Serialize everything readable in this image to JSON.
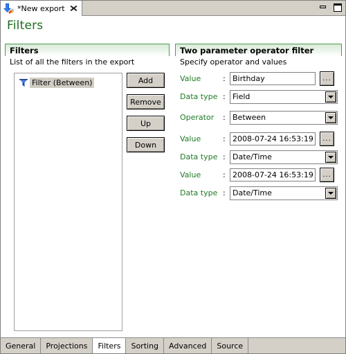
{
  "window": {
    "editor_tab": {
      "label": "*New export",
      "icon": "export-arrow-pencil-icon",
      "close_icon": "close-icon"
    },
    "controls": [
      {
        "name": "minimize-button",
        "icon": "minimize-icon"
      },
      {
        "name": "maximize-button",
        "icon": "maximize-icon"
      }
    ]
  },
  "page": {
    "title": "Filters"
  },
  "left_group": {
    "header": "Filters",
    "subtitle": "List of all the filters in the export",
    "tree": {
      "items": [
        {
          "label": "Filter (Between)",
          "icon": "funnel-icon",
          "selected": true
        }
      ]
    },
    "buttons": [
      {
        "name": "add-button",
        "label": "Add"
      },
      {
        "name": "remove-button",
        "label": "Remove"
      },
      {
        "name": "up-button",
        "label": "Up"
      },
      {
        "name": "down-button",
        "label": "Down"
      }
    ]
  },
  "right_group": {
    "header": "Two parameter operator filter",
    "subtitle": "Specify operator and values",
    "fields": {
      "value1_label": "Value",
      "value1": "Birthday",
      "datatype1_label": "Data type",
      "datatype1": "Field",
      "operator_label": "Operator",
      "operator": "Between",
      "value2_label": "Value",
      "value2": "2008-07-24 16:53:19",
      "datatype2_label": "Data type",
      "datatype2": "Date/Time",
      "value3_label": "Value",
      "value3": "2008-07-24 16:53:19",
      "datatype3_label": "Data type",
      "datatype3": "Date/Time",
      "colon": ":",
      "browse_label": "..."
    }
  },
  "bottom_tabs": [
    {
      "name": "tab-general",
      "label": "General",
      "active": false
    },
    {
      "name": "tab-projections",
      "label": "Projections",
      "active": false
    },
    {
      "name": "tab-filters",
      "label": "Filters",
      "active": true
    },
    {
      "name": "tab-sorting",
      "label": "Sorting",
      "active": false
    },
    {
      "name": "tab-advanced",
      "label": "Advanced",
      "active": false
    },
    {
      "name": "tab-source",
      "label": "Source",
      "active": false
    }
  ],
  "colors": {
    "accent_green": "#1d6b21",
    "label_green": "#1d7a22",
    "group_border": "#4e9a52",
    "chrome": "#d4d0c8",
    "selection": "#d0cdc4"
  }
}
